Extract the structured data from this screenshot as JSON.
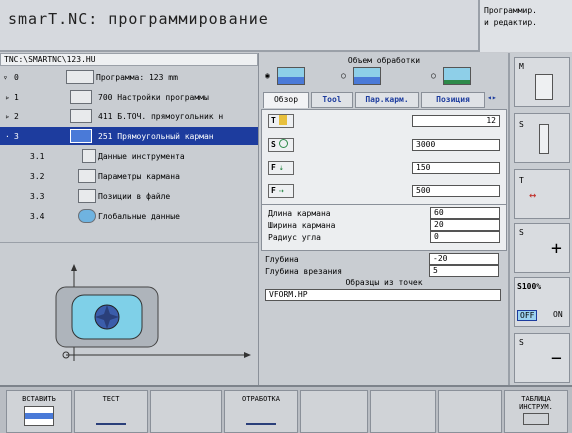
{
  "header": {
    "title": "smarT.NC: программирование",
    "mode_line1": "Программир.",
    "mode_line2": "и редактир."
  },
  "tree": {
    "path": "TNC:\\SMARTNC\\123.HU",
    "rows": [
      {
        "num": "0",
        "label": "Программа: 123 mm"
      },
      {
        "num": "1",
        "label": "700 Настройки программы"
      },
      {
        "num": "2",
        "label": "411 Б.ТОЧ. прямоугольник н"
      },
      {
        "num": "3",
        "label": "251 Прямоугольный карман"
      },
      {
        "num": "3.1",
        "label": "Данные инструмента"
      },
      {
        "num": "3.2",
        "label": "Параметры кармана"
      },
      {
        "num": "3.3",
        "label": "Позиции в файле"
      },
      {
        "num": "3.4",
        "label": "Глобальные данные"
      }
    ]
  },
  "form": {
    "title": "Объем обработки",
    "tabs": [
      "Обзор",
      "Tool",
      "Пар.карм.",
      "Позиция"
    ],
    "tool_prefix": "T",
    "tool_value": "12",
    "s_prefix": "S",
    "s_value": "3000",
    "f1_prefix": "F",
    "f1_value": "150",
    "f2_prefix": "F",
    "f2_value": "500",
    "fields": [
      {
        "label": "Длина кармана",
        "value": "60"
      },
      {
        "label": "Ширина кармана",
        "value": "20"
      },
      {
        "label": "Радиус угла",
        "value": "0"
      },
      {
        "label": "Глубина",
        "value": "-20"
      },
      {
        "label": "Глубина врезания",
        "value": "5"
      }
    ],
    "patterns_label": "Образцы из точек",
    "patterns_value": "VFORM.HP"
  },
  "side": {
    "m": "M",
    "s1": "S",
    "t": "T",
    "s2": "S",
    "override": "S100%",
    "off": "OFF",
    "on": "ON",
    "s3": "S"
  },
  "softkeys": {
    "insert": "ВСТАВИТЬ",
    "test": "ТЕСТ",
    "machining": "ОТРАБОТКА",
    "table_line1": "ТАБЛИЦА",
    "table_line2": "ИНСТРУМ."
  },
  "colors": {
    "selection": "#1d3c9e",
    "accent_blue": "#4a7ad8"
  }
}
